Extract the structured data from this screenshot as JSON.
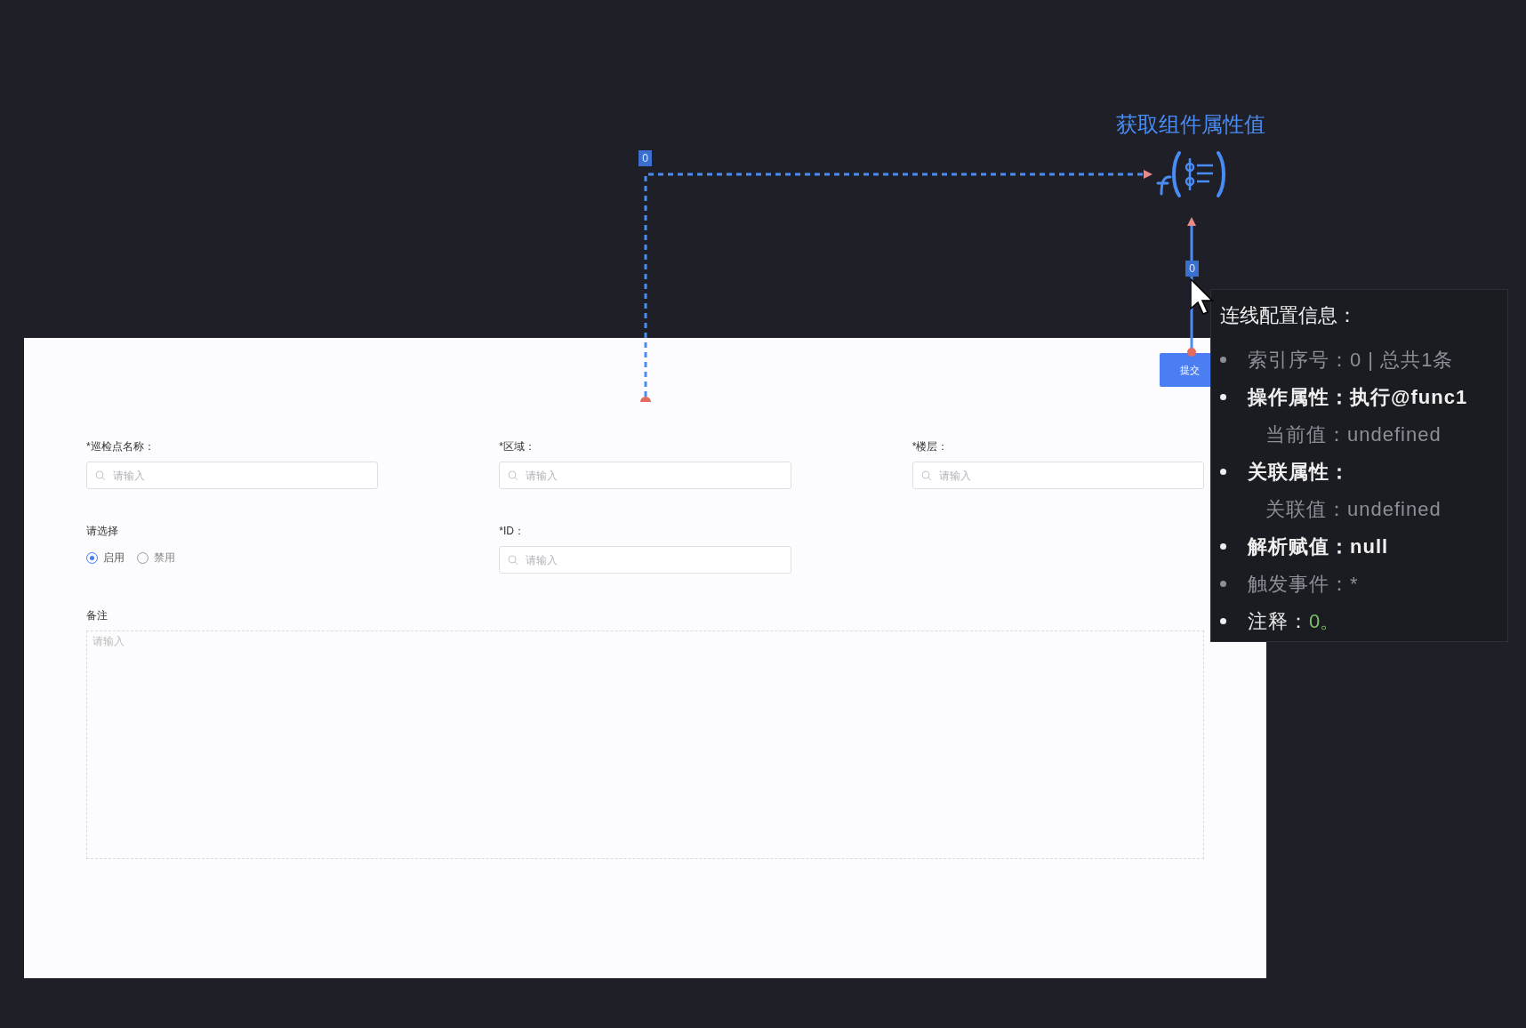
{
  "canvas": {
    "node": {
      "title": "获取组件属性值"
    },
    "connectors": [
      {
        "label": "0"
      },
      {
        "label": "0"
      }
    ],
    "form": {
      "submit_button": "提交",
      "fields": [
        {
          "kind": "input",
          "label": "*巡检点名称：",
          "placeholder": "请输入"
        },
        {
          "kind": "input",
          "label": "*区域：",
          "placeholder": "请输入"
        },
        {
          "kind": "input",
          "label": "*楼层：",
          "placeholder": "请输入"
        },
        {
          "kind": "radio",
          "label": "请选择",
          "options": [
            {
              "label": "启用",
              "selected": true
            },
            {
              "label": "禁用",
              "selected": false
            }
          ]
        },
        {
          "kind": "input",
          "label": "*ID：",
          "placeholder": "请输入"
        },
        {
          "kind": "textarea",
          "label": "备注",
          "placeholder": "请输入"
        }
      ]
    }
  },
  "tooltip": {
    "title": "连线配置信息：",
    "items": [
      {
        "kind": "bullet",
        "bold": false,
        "muted": true,
        "text": "索引序号：0 | 总共1条"
      },
      {
        "kind": "bullet",
        "bold": true,
        "muted": false,
        "text": "操作属性：执行@func1"
      },
      {
        "kind": "sub",
        "bold": false,
        "muted": true,
        "text": "当前值：undefined"
      },
      {
        "kind": "bullet",
        "bold": true,
        "muted": false,
        "text": "关联属性："
      },
      {
        "kind": "sub",
        "bold": false,
        "muted": true,
        "text": "关联值：undefined"
      },
      {
        "kind": "bullet",
        "bold": true,
        "muted": false,
        "text": "解析赋值：null"
      },
      {
        "kind": "bullet",
        "bold": false,
        "muted": true,
        "text": "触发事件：*"
      },
      {
        "kind": "bullet",
        "bold": false,
        "muted": false,
        "text": "注释：",
        "value": "0。"
      }
    ]
  }
}
